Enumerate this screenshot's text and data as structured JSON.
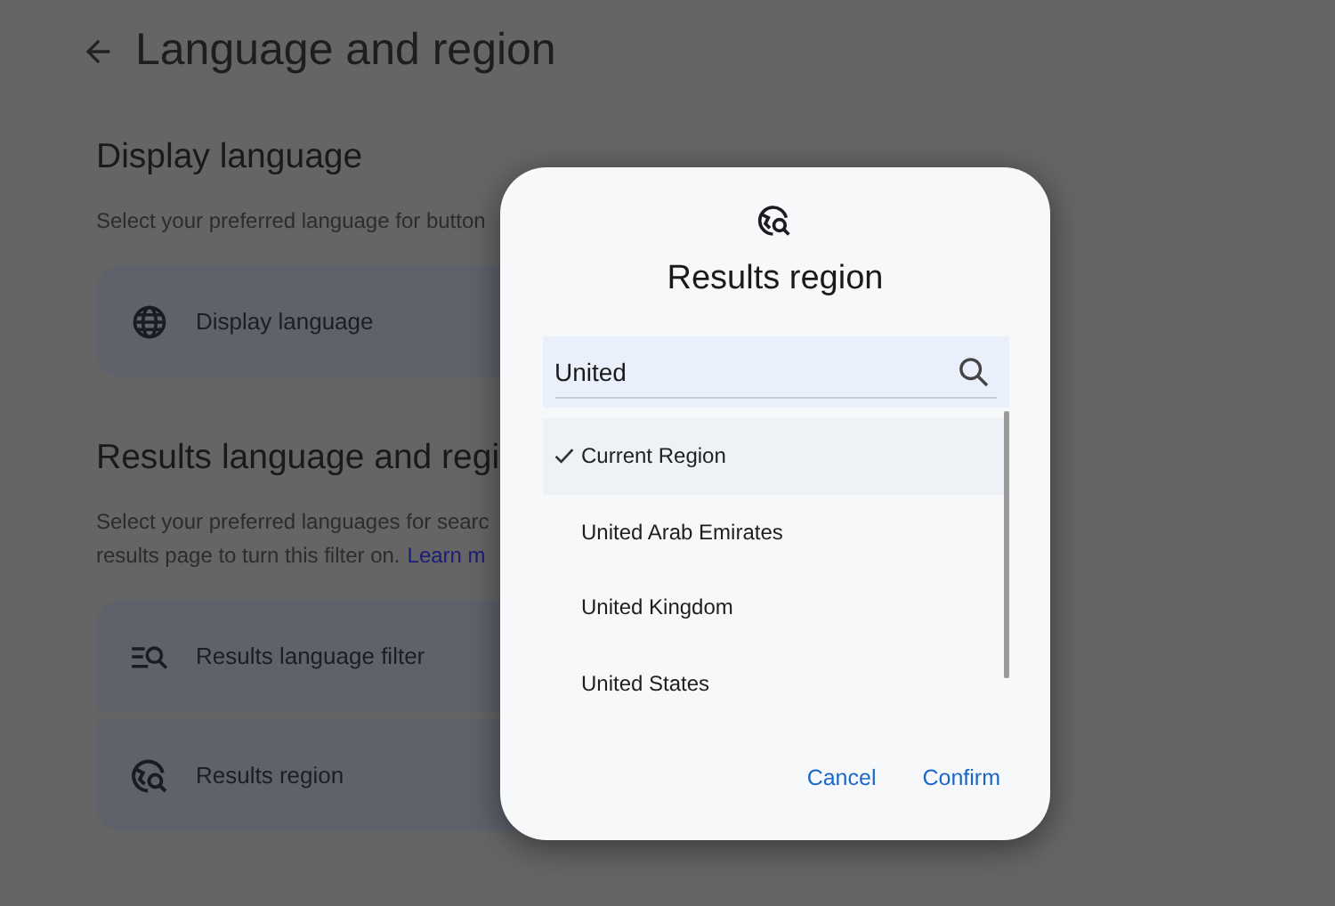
{
  "page": {
    "title": "Language and region"
  },
  "sections": [
    {
      "heading": "Display language",
      "description": "Select your preferred language for button",
      "items": [
        {
          "kind": "globe",
          "label": "Display language"
        }
      ]
    },
    {
      "heading": "Results language and regi",
      "description": "Select your preferred languages for searc",
      "description_2": "results page to turn this filter on.",
      "link": "Learn m",
      "items": [
        {
          "kind": "filter",
          "label": "Results language filter"
        },
        {
          "kind": "region",
          "label": "Results region"
        }
      ]
    }
  ],
  "dialog": {
    "title": "Results region",
    "search": {
      "value": "United"
    },
    "options": [
      {
        "label": "Current Region",
        "selected": true
      },
      {
        "label": "United Arab Emirates",
        "selected": false
      },
      {
        "label": "United Kingdom",
        "selected": false
      },
      {
        "label": "United States",
        "selected": false
      }
    ],
    "buttons": [
      "Cancel",
      "Confirm"
    ]
  }
}
